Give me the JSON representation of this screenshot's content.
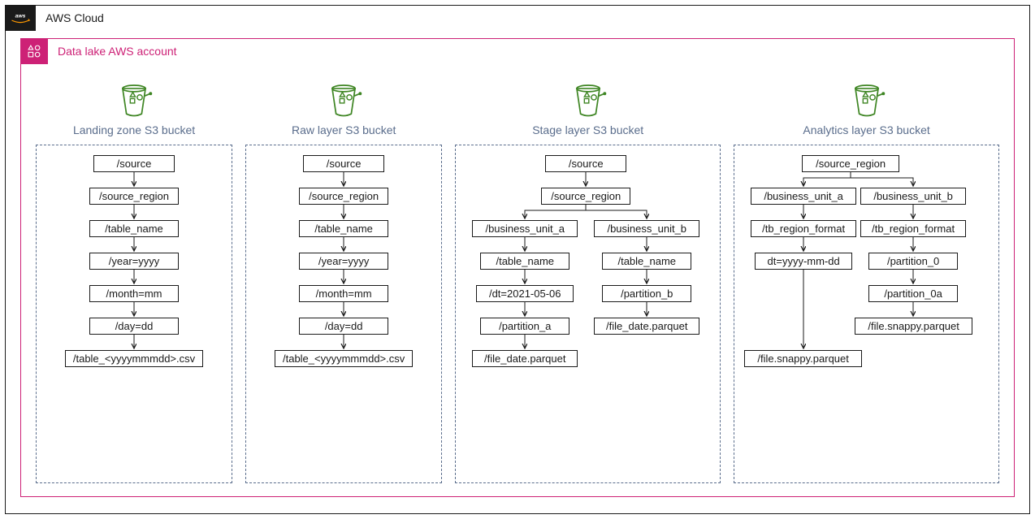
{
  "cloud": {
    "title": "AWS Cloud"
  },
  "account": {
    "title": "Data lake AWS account"
  },
  "buckets": {
    "landing": {
      "title": "Landing zone S3 bucket",
      "n0": "/source",
      "n1": "/source_region",
      "n2": "/table_name",
      "n3": "/year=yyyy",
      "n4": "/month=mm",
      "n5": "/day=dd",
      "n6": "/table_<yyyymmmdd>.csv"
    },
    "raw": {
      "title": "Raw layer S3 bucket",
      "n0": "/source",
      "n1": "/source_region",
      "n2": "/table_name",
      "n3": "/year=yyyy",
      "n4": "/month=mm",
      "n5": "/day=dd",
      "n6": "/table_<yyyymmmdd>.csv"
    },
    "stage": {
      "title": "Stage layer S3 bucket",
      "n0": "/source",
      "n1": "/source_region",
      "lA": "/business_unit_a",
      "rB": "/business_unit_b",
      "lTable": "/table_name",
      "rTable": "/table_name",
      "lDt": "/dt=2021-05-06",
      "rPart": "/partition_b",
      "lPart": "/partition_a",
      "rFile": "/file_date.parquet",
      "lFile": "/file_date.parquet"
    },
    "analytics": {
      "title": "Analytics layer S3 bucket",
      "n0": "/source_region",
      "lA": "/business_unit_a",
      "rB": "/business_unit_b",
      "lTb": "/tb_region_format",
      "rTb": "/tb_region_format",
      "lDt": "dt=yyyy-mm-dd",
      "rP0": "/partition_0",
      "rP0a": "/partition_0a",
      "lFile": "/file.snappy.parquet",
      "rFile": "/file.snappy.parquet"
    }
  }
}
